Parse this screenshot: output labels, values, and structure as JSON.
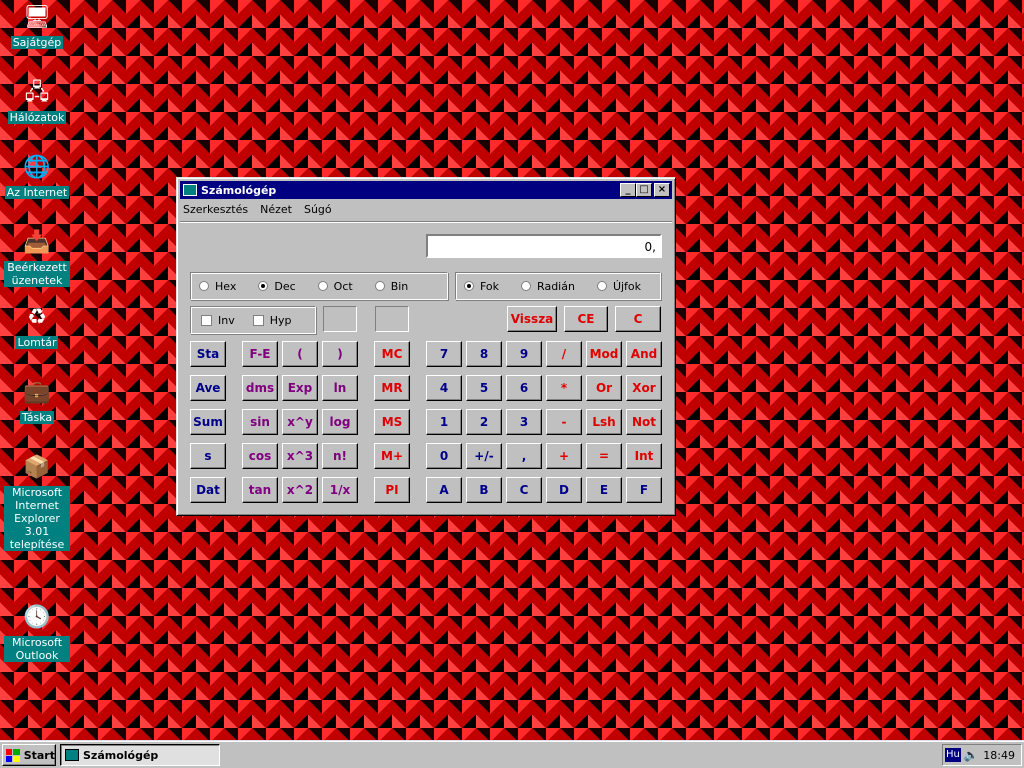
{
  "desktop": {
    "icons": [
      {
        "label": "Sajátgép",
        "icon": "my-computer-icon",
        "glyph": "🖥"
      },
      {
        "label": "Hálózatok",
        "icon": "network-icon",
        "glyph": "🖧"
      },
      {
        "label": "Az Internet",
        "icon": "internet-globe-icon",
        "glyph": "🌐"
      },
      {
        "label": "Beérkezett üzenetek",
        "icon": "inbox-icon",
        "glyph": "📥"
      },
      {
        "label": "Lomtár",
        "icon": "recycle-bin-icon",
        "glyph": "♻"
      },
      {
        "label": "Táska",
        "icon": "briefcase-icon",
        "glyph": "💼"
      },
      {
        "label": "Microsoft Internet Explorer 3.01 telepítése",
        "icon": "ie-setup-icon",
        "glyph": "📦"
      },
      {
        "label": "Microsoft Outlook",
        "icon": "outlook-icon",
        "glyph": "🕓"
      }
    ]
  },
  "window": {
    "title": "Számológép",
    "controls": {
      "minimize": "_",
      "maximize": "□",
      "close": "×"
    },
    "menu": [
      "Szerkesztés",
      "Nézet",
      "Súgó"
    ],
    "display": "0,",
    "number_system": [
      "Hex",
      "Dec",
      "Oct",
      "Bin"
    ],
    "number_system_selected": "Dec",
    "angle_unit": [
      "Fok",
      "Radián",
      "Újfok"
    ],
    "angle_unit_selected": "Fok",
    "checkboxes": [
      "Inv",
      "Hyp"
    ],
    "edit_buttons": [
      "Vissza",
      "CE",
      "C"
    ],
    "stat_buttons": [
      "Sta",
      "Ave",
      "Sum",
      "s",
      "Dat"
    ],
    "sci_col1": [
      "F-E",
      "dms",
      "sin",
      "cos",
      "tan"
    ],
    "sci_col2": [
      "(",
      "Exp",
      "x^y",
      "x^3",
      "x^2"
    ],
    "sci_col3": [
      ")",
      "ln",
      "log",
      "n!",
      "1/x"
    ],
    "memory_buttons": [
      "MC",
      "MR",
      "MS",
      "M+",
      "PI"
    ],
    "digits": [
      [
        "7",
        "8",
        "9"
      ],
      [
        "4",
        "5",
        "6"
      ],
      [
        "1",
        "2",
        "3"
      ],
      [
        "0",
        "+/-",
        ","
      ],
      [
        "A",
        "B",
        "C"
      ]
    ],
    "ops_col1": [
      "/",
      "*",
      "-",
      "+",
      "D"
    ],
    "ops_col2": [
      "Mod",
      "Or",
      "Lsh",
      "=",
      "E"
    ],
    "ops_col3": [
      "And",
      "Xor",
      "Not",
      "Int",
      "F"
    ]
  },
  "taskbar": {
    "start_label": "Start",
    "task_label": "Számológép",
    "lang": "Hu",
    "clock": "18:49"
  }
}
